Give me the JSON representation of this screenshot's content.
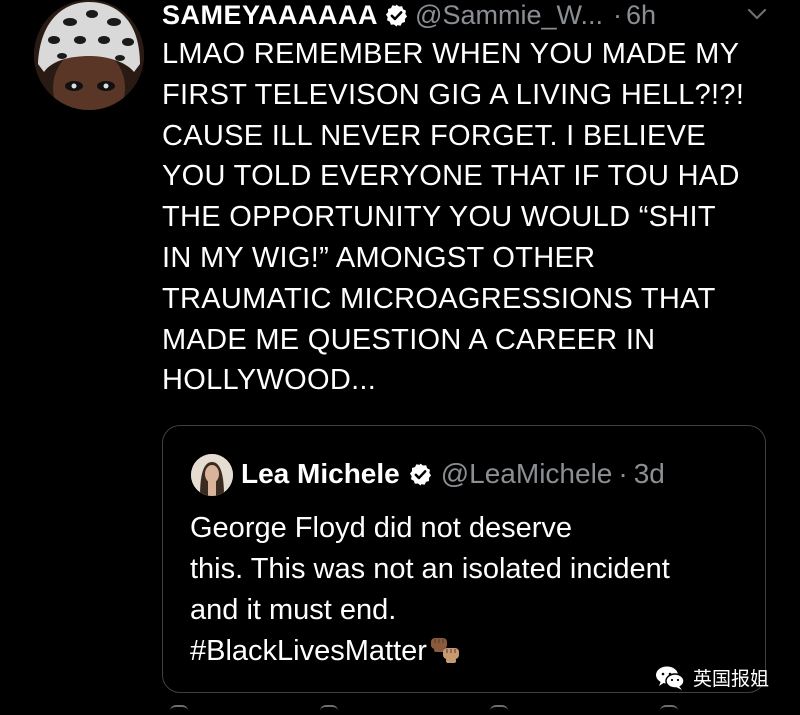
{
  "tweet": {
    "display_name": "SAMEYAAAAAA",
    "handle": "@Sammie_W...",
    "separator": "·",
    "time": "6h",
    "text": "LMAO REMEMBER WHEN YOU MADE MY\nFIRST TELEVISON GIG A LIVING HELL?!?!\nCAUSE ILL NEVER FORGET. I BELIEVE\nYOU TOLD EVERYONE THAT IF TOU HAD\nTHE OPPORTUNITY YOU WOULD “SHIT\nIN MY WIG!” AMONGST OTHER\nTRAUMATIC MICROAGRESSIONS THAT\nMADE ME QUESTION A CAREER IN\nHOLLYWOOD...",
    "avatar_icon": "avatar-leopard-hat",
    "verified_icon": "verified-badge-icon",
    "menu_icon": "chevron-down-icon"
  },
  "quoted_tweet": {
    "display_name": "Lea Michele",
    "handle": "@LeaMichele",
    "separator": "·",
    "time": "3d",
    "text": "George Floyd did not deserve\nthis. This was not an isolated incident\nand it must end.\n#BlackLivesMatter",
    "emoji_icon": "raised-fist-icon"
  },
  "watermark": {
    "label": "英国报姐",
    "icon": "wechat-icon"
  },
  "colors": {
    "background": "#000000",
    "text": "#ffffff",
    "muted": "#8b8f94",
    "border": "#3c4044"
  }
}
